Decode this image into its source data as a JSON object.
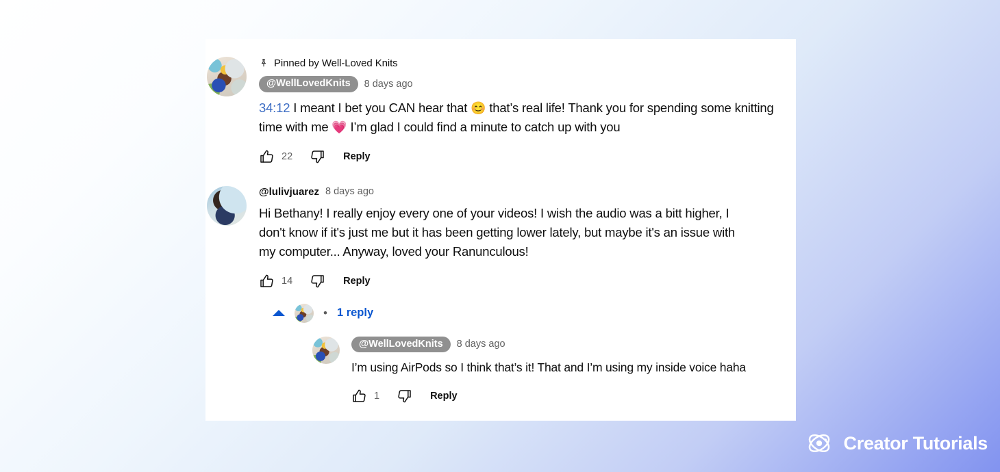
{
  "watermark": {
    "brand": "Creator Tutorials",
    "logo_icon": "atom-orbit-icon",
    "text_color": "#ffffff"
  },
  "theme": {
    "background_start": "#ffffff",
    "background_end": "#8293f0",
    "card_background": "#ffffff",
    "link_color": "#0b57d0",
    "timestamp_link_color": "#3e6ec4",
    "author_chip_background": "#909090",
    "secondary_text": "#606060",
    "primary_text": "#0f0f0f"
  },
  "comments": [
    {
      "pinned_label": "Pinned by Well-Loved Knits",
      "pin_icon": "pin-icon",
      "avatar": "av-knits",
      "author": "@WellLovedKnits",
      "author_is_creator": true,
      "timestamp": "8 days ago",
      "text_timestamp_link": "34:12",
      "text_part_1": " I meant I bet you CAN hear that ",
      "emoji_1": "😊",
      "text_part_2": " that’s real life! Thank you for spending some knitting time with me ",
      "emoji_2": "💗",
      "text_part_3": " I’m glad I could find a minute to catch up with you",
      "like_count": "22",
      "like_icon": "thumbs-up-icon",
      "dislike_icon": "thumbs-down-icon",
      "reply_label": "Reply"
    },
    {
      "avatar": "av-luliv",
      "author": "@lulivjuarez",
      "author_is_creator": false,
      "timestamp": "8 days ago",
      "text": "Hi Bethany! I really enjoy every one of your videos! I wish the audio was a bitt higher,  I don't know if it's just me but it has been getting lower lately, but maybe it's an issue with my computer... Anyway, loved your Ranunculous!",
      "like_count": "14",
      "like_icon": "thumbs-up-icon",
      "dislike_icon": "thumbs-down-icon",
      "reply_label": "Reply",
      "replies_toggle": {
        "expanded": true,
        "chevron_icon": "chevron-up-icon",
        "separator": "•",
        "label": "1 reply",
        "avatar": "av-knits"
      },
      "replies": [
        {
          "avatar": "av-knits",
          "author": "@WellLovedKnits",
          "author_is_creator": true,
          "timestamp": "8 days ago",
          "text": "I’m using AirPods so I think that’s it! That and I’m using my inside voice haha",
          "like_count": "1",
          "like_icon": "thumbs-up-icon",
          "dislike_icon": "thumbs-down-icon",
          "reply_label": "Reply"
        }
      ]
    }
  ]
}
